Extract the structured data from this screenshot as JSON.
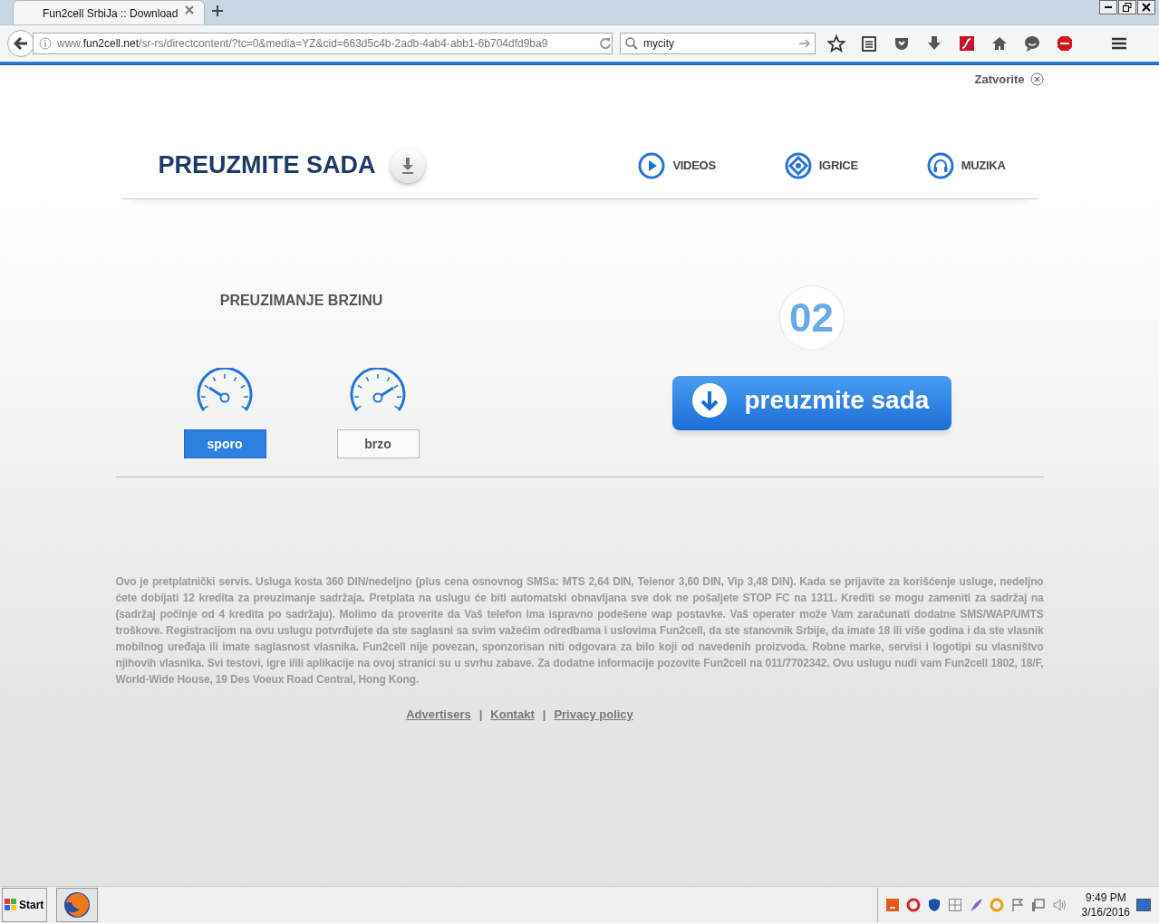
{
  "browser": {
    "tab_title": "Fun2cell SrbiJa :: Download",
    "url": "www.**fun2cell.net**/sr-rs/directcontent/?tc=0&media=YZ&cid=663d5c4b-2adb-4ab4-abb1-6b704dfd9ba9",
    "search_value": "mycity"
  },
  "page": {
    "close_label": "Zatvorite",
    "title": "PREUZMITE SADA",
    "nav": [
      {
        "label": "VIDEOS",
        "kind": "play"
      },
      {
        "label": "IGRICE",
        "kind": "diamond"
      },
      {
        "label": "MUZIKA",
        "kind": "headphones"
      }
    ],
    "speed_title": "PREUZIMANJE BRZINU",
    "speed_options": [
      {
        "label": "sporo",
        "kind": "slow",
        "selected": true
      },
      {
        "label": "brzo",
        "kind": "fast",
        "selected": false
      }
    ],
    "countdown": "02",
    "download_button": "preuzmite sada",
    "disclaimer": "Ovo je pretplatnički servis. Usluga kosta 360 DIN/nedeljno (plus cena osnovnog SMSa: MTS 2,64 DIN, Telenor 3,60 DIN, Vip 3,48 DIN). Kada se prijavite za korišćenje usluge, nedeljno ćete dobijati 12 kredita za preuzimanje sadržaja. Pretplata na uslugu će biti automatski obnavljana sve dok ne pošaljete STOP FC na 1311. Krediti se mogu zameniti za sadržaj na (sadržaj počinje od 4 kredita po sadržaju). Molimo da proverite da Vaš telefon ima ispravno podešene wap postavke. Vaš operater može Vam zaračunati dodatne SMS/WAP/UMTS troškove. Registracijom na ovu uslugu potvrđujete da ste saglasni sa svim važećim odredbama i uslovima  Fun2cell, da ste stanovnik Srbije, da imate 18 ili više godina i da ste vlasnik mobilnog uređaja ili imate saglasnost vlasnika. Fun2cell nije povezan, sponzorisan niti odgovara za bilo koji od navedenih proizvoda. Robne marke, servisi i logotipi su vlasništvo njihovih vlasnika.  Svi testovi, igre i/ili aplikacije na ovoj stranici su u svrhu zabave. Za dodatne informacije pozovite Fun2cell na 011/7702342. Ovu uslugu nudi vam Fun2cell 1802, 18/F, World-Wide House, 19 Des Voeux Road Central, Hong Kong.",
    "footer_links": [
      "Advertisers",
      "Kontakt",
      "Privacy policy"
    ],
    "footer_separator": "|"
  },
  "taskbar": {
    "start": "Start",
    "time": "9:49 PM",
    "date": "3/16/2016"
  }
}
